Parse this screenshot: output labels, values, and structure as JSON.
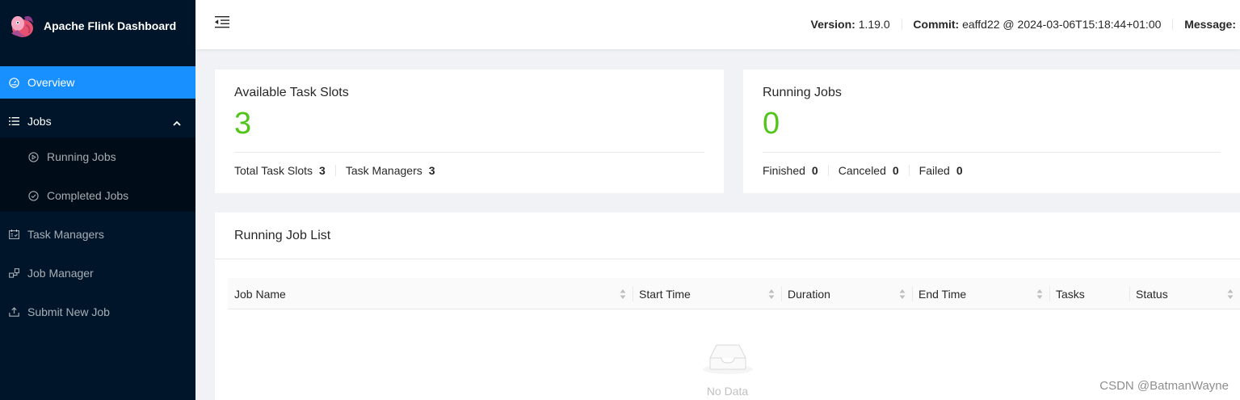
{
  "app": {
    "title": "Apache Flink Dashboard"
  },
  "sidebar": {
    "items": [
      {
        "label": "Overview"
      },
      {
        "label": "Jobs"
      },
      {
        "label": "Task Managers"
      },
      {
        "label": "Job Manager"
      },
      {
        "label": "Submit New Job"
      }
    ],
    "jobs_sub": [
      {
        "label": "Running Jobs"
      },
      {
        "label": "Completed Jobs"
      }
    ]
  },
  "header": {
    "version_label": "Version:",
    "version": "1.19.0",
    "commit_label": "Commit:",
    "commit": "eaffd22 @ 2024-03-06T15:18:44+01:00",
    "message_label": "Message:"
  },
  "slots_card": {
    "title": "Available Task Slots",
    "value": "3",
    "total_label": "Total Task Slots",
    "total_value": "3",
    "tm_label": "Task Managers",
    "tm_value": "3"
  },
  "jobs_card": {
    "title": "Running Jobs",
    "value": "0",
    "finished_label": "Finished",
    "finished_value": "0",
    "canceled_label": "Canceled",
    "canceled_value": "0",
    "failed_label": "Failed",
    "failed_value": "0"
  },
  "job_list": {
    "title": "Running Job List",
    "columns": [
      "Job Name",
      "Start Time",
      "Duration",
      "End Time",
      "Tasks",
      "Status"
    ],
    "empty_text": "No Data"
  },
  "watermark": "CSDN @BatmanWayne",
  "colors": {
    "accent": "#1890ff",
    "sidebar": "#001529",
    "success": "#52c41a"
  }
}
